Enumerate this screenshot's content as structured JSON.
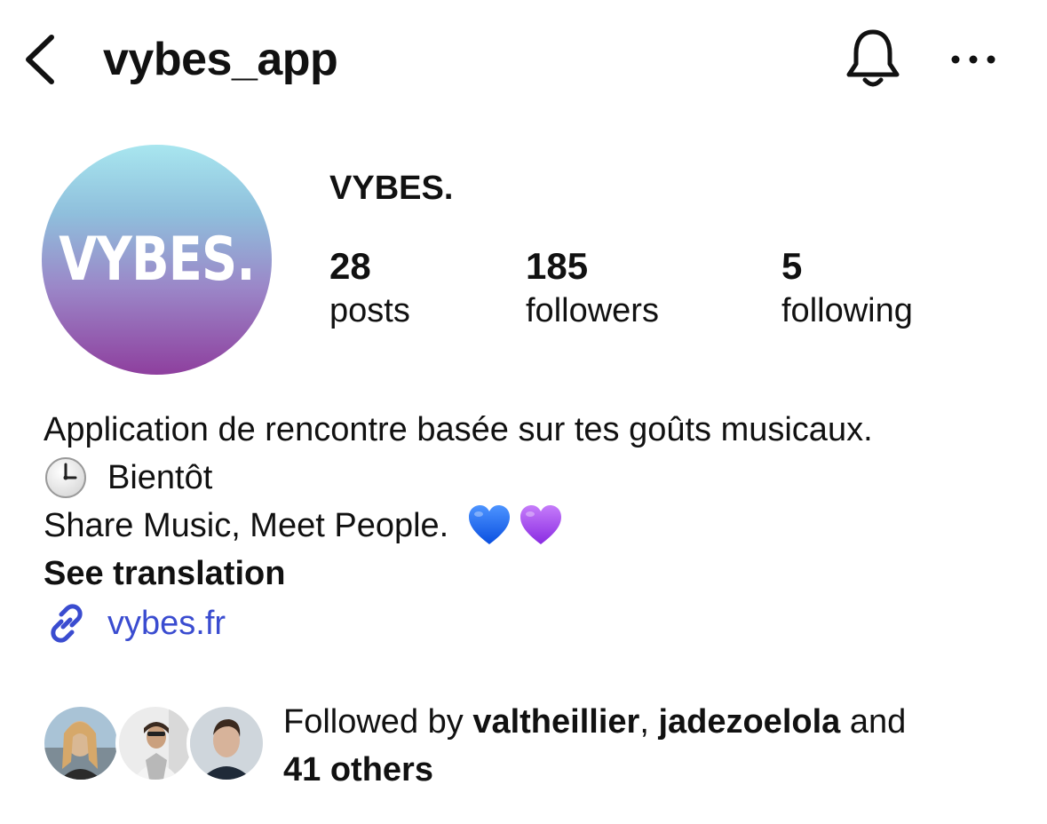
{
  "header": {
    "title": "vybes_app",
    "back_icon": "chevron-left-icon",
    "notification_icon": "bell-icon",
    "more_icon": "ellipsis-icon"
  },
  "profile": {
    "avatar_text": "VYBES.",
    "display_name": "VYBES.",
    "stats": {
      "posts_count": "28",
      "posts_label": "posts",
      "followers_count": "185",
      "followers_label": "followers",
      "following_count": "5",
      "following_label": "following"
    },
    "bio": {
      "line1": "Application de rencontre basée sur tes goûts musicaux.",
      "line2": "Bientôt",
      "line3": "Share Music, Meet People.",
      "see_translation": "See translation"
    },
    "link": {
      "text": "vybes.fr"
    },
    "followed_by": {
      "prefix": "Followed by ",
      "user1": "valtheillier",
      "separator": ", ",
      "user2": "jadezoelola",
      "conjunction": " and",
      "others": "41 others"
    }
  },
  "colors": {
    "link": "#3a4cd0",
    "heart_blue": "#1e6cff",
    "heart_purple": "#a64cf2",
    "avatar_top": "#a8e6ef",
    "avatar_bottom": "#8e3f9e"
  }
}
